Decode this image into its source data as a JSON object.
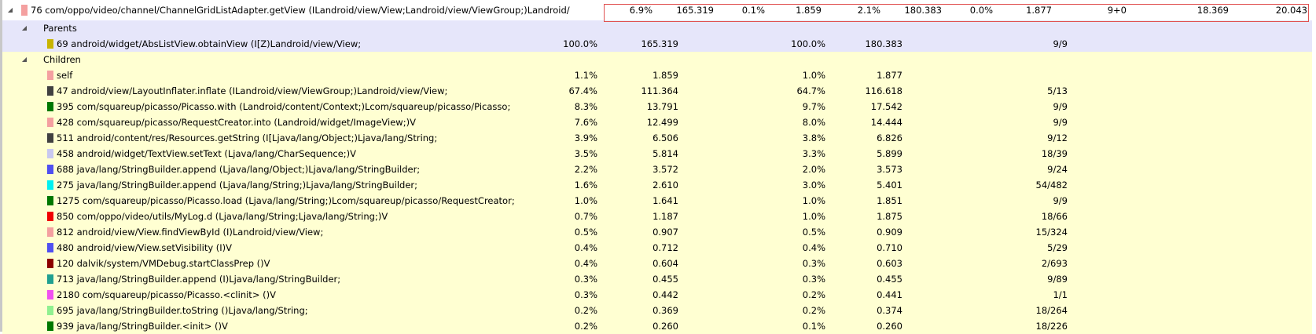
{
  "top": {
    "name": "76 com/oppo/video/channel/ChannelGridListAdapter.getView (ILandroid/view/View;Landroid/view/ViewGroup;)Landroid/",
    "color": "#f4a0a0",
    "incl_cpu_pct": "6.9%",
    "incl_cpu_time": "165.319",
    "excl_cpu_pct": "0.1%",
    "excl_cpu_time": "1.859",
    "incl_real_pct": "2.1%",
    "incl_real_time": "180.383",
    "excl_real_pct": "0.0%",
    "excl_real_time": "1.877",
    "calls": "9+0",
    "cpu_per_call": "18.369",
    "real_per_call": "20.043"
  },
  "parents": {
    "label": "Parents",
    "rows": [
      {
        "name": "69 android/widget/AbsListView.obtainView (I[Z)Landroid/view/View;",
        "color": "#c8b400",
        "c1": "100.0%",
        "c2": "165.319",
        "c3": "100.0%",
        "c4": "180.383",
        "calls": "9/9"
      }
    ]
  },
  "children": {
    "label": "Children",
    "rows": [
      {
        "name": "self",
        "color": "#f4a0a0",
        "c1": "1.1%",
        "c2": "1.859",
        "c3": "1.0%",
        "c4": "1.877",
        "calls": ""
      },
      {
        "name": "47 android/view/LayoutInflater.inflate (ILandroid/view/ViewGroup;)Landroid/view/View;",
        "color": "#404040",
        "c1": "67.4%",
        "c2": "111.364",
        "c3": "64.7%",
        "c4": "116.618",
        "calls": "5/13"
      },
      {
        "name": "395 com/squareup/picasso/Picasso.with (Landroid/content/Context;)Lcom/squareup/picasso/Picasso;",
        "color": "#007800",
        "c1": "8.3%",
        "c2": "13.791",
        "c3": "9.7%",
        "c4": "17.542",
        "calls": "9/9"
      },
      {
        "name": "428 com/squareup/picasso/RequestCreator.into (Landroid/widget/ImageView;)V",
        "color": "#f4a0a0",
        "c1": "7.6%",
        "c2": "12.499",
        "c3": "8.0%",
        "c4": "14.444",
        "calls": "9/9"
      },
      {
        "name": "511 android/content/res/Resources.getString (I[Ljava/lang/Object;)Ljava/lang/String;",
        "color": "#404040",
        "c1": "3.9%",
        "c2": "6.506",
        "c3": "3.8%",
        "c4": "6.826",
        "calls": "9/12"
      },
      {
        "name": "458 android/widget/TextView.setText (Ljava/lang/CharSequence;)V",
        "color": "#c8c8f0",
        "c1": "3.5%",
        "c2": "5.814",
        "c3": "3.3%",
        "c4": "5.899",
        "calls": "18/39"
      },
      {
        "name": "688 java/lang/StringBuilder.append (Ljava/lang/Object;)Ljava/lang/StringBuilder;",
        "color": "#5050f0",
        "c1": "2.2%",
        "c2": "3.572",
        "c3": "2.0%",
        "c4": "3.573",
        "calls": "9/24"
      },
      {
        "name": "275 java/lang/StringBuilder.append (Ljava/lang/String;)Ljava/lang/StringBuilder;",
        "color": "#00f0f0",
        "c1": "1.6%",
        "c2": "2.610",
        "c3": "3.0%",
        "c4": "5.401",
        "calls": "54/482"
      },
      {
        "name": "1275 com/squareup/picasso/Picasso.load (Ljava/lang/String;)Lcom/squareup/picasso/RequestCreator;",
        "color": "#007800",
        "c1": "1.0%",
        "c2": "1.641",
        "c3": "1.0%",
        "c4": "1.851",
        "calls": "9/9"
      },
      {
        "name": "850 com/oppo/video/utils/MyLog.d (Ljava/lang/String;Ljava/lang/String;)V",
        "color": "#f00000",
        "c1": "0.7%",
        "c2": "1.187",
        "c3": "1.0%",
        "c4": "1.875",
        "calls": "18/66"
      },
      {
        "name": "812 android/view/View.findViewById (I)Landroid/view/View;",
        "color": "#f4a0a0",
        "c1": "0.5%",
        "c2": "0.907",
        "c3": "0.5%",
        "c4": "0.909",
        "calls": "15/324"
      },
      {
        "name": "480 android/view/View.setVisibility (I)V",
        "color": "#5050f0",
        "c1": "0.4%",
        "c2": "0.712",
        "c3": "0.4%",
        "c4": "0.710",
        "calls": "5/29"
      },
      {
        "name": "120 dalvik/system/VMDebug.startClassPrep ()V",
        "color": "#8c0000",
        "c1": "0.4%",
        "c2": "0.604",
        "c3": "0.3%",
        "c4": "0.603",
        "calls": "2/693"
      },
      {
        "name": "713 java/lang/StringBuilder.append (I)Ljava/lang/StringBuilder;",
        "color": "#20a090",
        "c1": "0.3%",
        "c2": "0.455",
        "c3": "0.3%",
        "c4": "0.455",
        "calls": "9/89"
      },
      {
        "name": "2180 com/squareup/picasso/Picasso.<clinit> ()V",
        "color": "#f050f0",
        "c1": "0.3%",
        "c2": "0.442",
        "c3": "0.2%",
        "c4": "0.441",
        "calls": "1/1"
      },
      {
        "name": "695 java/lang/StringBuilder.toString ()Ljava/lang/String;",
        "color": "#90f090",
        "c1": "0.2%",
        "c2": "0.369",
        "c3": "0.2%",
        "c4": "0.374",
        "calls": "18/264"
      },
      {
        "name": "939 java/lang/StringBuilder.<init> ()V",
        "color": "#007800",
        "c1": "0.2%",
        "c2": "0.260",
        "c3": "0.1%",
        "c4": "0.260",
        "calls": "18/226"
      }
    ]
  }
}
